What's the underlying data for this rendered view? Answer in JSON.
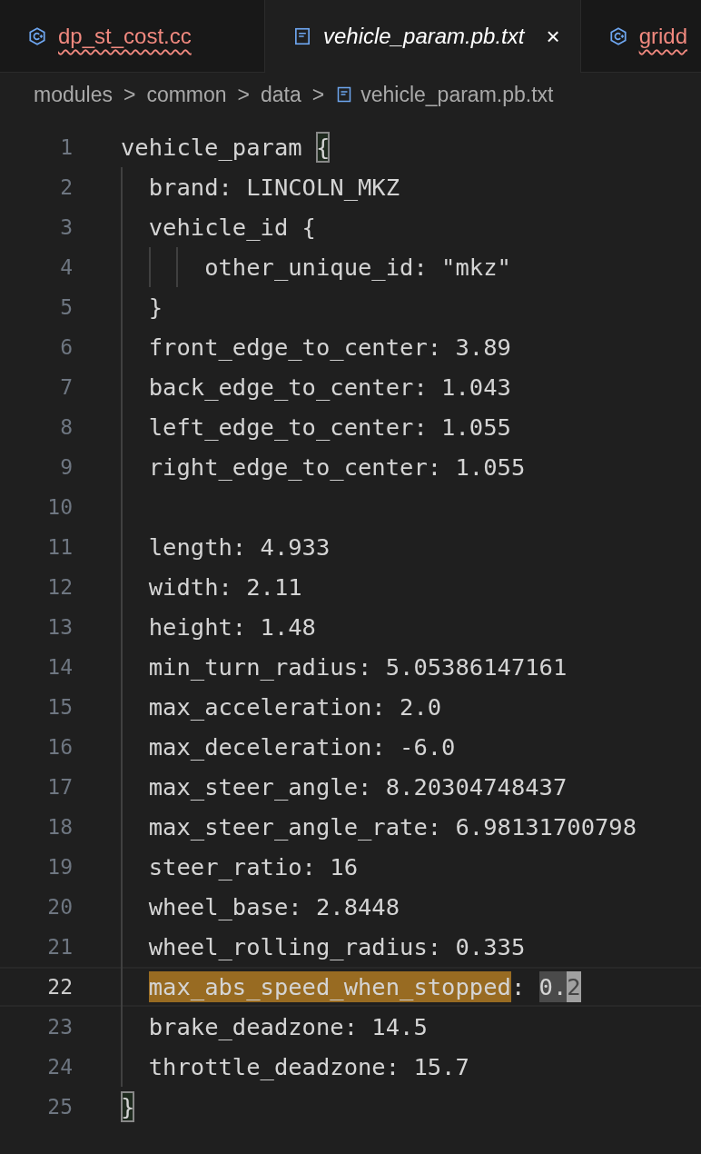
{
  "tabs": [
    {
      "label": "dp_st_cost.cc",
      "kind": "cpp",
      "selected": false,
      "has_error": true
    },
    {
      "label": "vehicle_param.pb.txt",
      "kind": "text",
      "selected": true,
      "has_error": false,
      "close": "×"
    },
    {
      "label": "gridd",
      "kind": "cpp",
      "selected": false,
      "has_error": true
    }
  ],
  "breadcrumbs": [
    {
      "label": "modules",
      "kind": "folder"
    },
    {
      "label": "common",
      "kind": "folder"
    },
    {
      "label": "data",
      "kind": "folder"
    },
    {
      "label": "vehicle_param.pb.txt",
      "kind": "text"
    }
  ],
  "breadcrumb_separator": ">",
  "lines": [
    {
      "number": "1",
      "current": false,
      "segments": [
        {
          "text": "vehicle_param ",
          "kind": "plain"
        },
        {
          "text": "{",
          "kind": "bracket_match"
        }
      ]
    },
    {
      "number": "2",
      "current": false,
      "code": "  brand: LINCOLN_MKZ"
    },
    {
      "number": "3",
      "current": false,
      "code": "  vehicle_id {"
    },
    {
      "number": "4",
      "current": false,
      "code": "      other_unique_id: \"mkz\""
    },
    {
      "number": "5",
      "current": false,
      "code": "  }"
    },
    {
      "number": "6",
      "current": false,
      "code": "  front_edge_to_center: 3.89"
    },
    {
      "number": "7",
      "current": false,
      "code": "  back_edge_to_center: 1.043"
    },
    {
      "number": "8",
      "current": false,
      "code": "  left_edge_to_center: 1.055"
    },
    {
      "number": "9",
      "current": false,
      "code": "  right_edge_to_center: 1.055"
    },
    {
      "number": "10",
      "current": false
    },
    {
      "number": "11",
      "current": false,
      "code": "  length: 4.933"
    },
    {
      "number": "12",
      "current": false,
      "code": "  width: 2.11"
    },
    {
      "number": "13",
      "current": false,
      "code": "  height: 1.48"
    },
    {
      "number": "14",
      "current": false,
      "code": "  min_turn_radius: 5.05386147161"
    },
    {
      "number": "15",
      "current": false,
      "code": "  max_acceleration: 2.0"
    },
    {
      "number": "16",
      "current": false,
      "code": "  max_deceleration: -6.0"
    },
    {
      "number": "17",
      "current": false,
      "code": "  max_steer_angle: 8.20304748437"
    },
    {
      "number": "18",
      "current": false,
      "code": "  max_steer_angle_rate: 6.98131700798"
    },
    {
      "number": "19",
      "current": false,
      "code": "  steer_ratio: 16"
    },
    {
      "number": "20",
      "current": false,
      "code": "  wheel_base: 2.8448"
    },
    {
      "number": "21",
      "current": false,
      "code": "  wheel_rolling_radius: 0.335"
    },
    {
      "number": "22",
      "current": true,
      "segments": [
        {
          "text": "  max_abs_speed_when_stopped",
          "kind": "search_match"
        },
        {
          "text": ": ",
          "kind": "plain"
        },
        {
          "text": "0.",
          "kind": "selection"
        },
        {
          "text": "2",
          "kind": "cursor"
        }
      ]
    },
    {
      "number": "23",
      "current": false,
      "code": "  brake_deadzone: 14.5"
    },
    {
      "number": "24",
      "current": false,
      "code": "  throttle_deadzone: 15.7"
    },
    {
      "number": "25",
      "current": false,
      "segments": [
        {
          "text": "}",
          "kind": "bracket_match"
        }
      ]
    }
  ]
}
